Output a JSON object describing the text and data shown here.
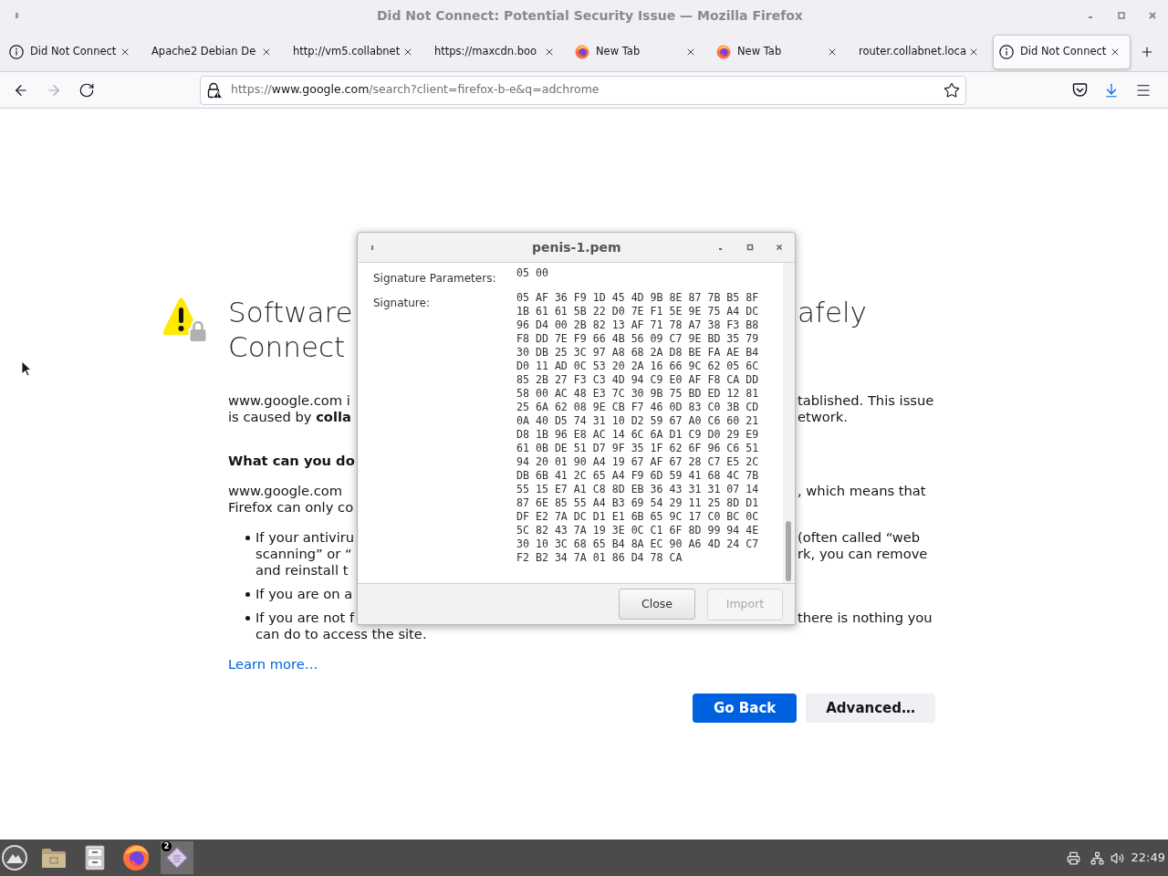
{
  "window": {
    "title": "Did Not Connect: Potential Security Issue — Mozilla Firefox"
  },
  "tabs": [
    {
      "label": "Did Not Connect",
      "kind": "info",
      "selected": false
    },
    {
      "label": "Apache2 Debian De",
      "kind": "plain",
      "selected": false
    },
    {
      "label": "http://vm5.collabnet",
      "kind": "plain",
      "selected": false
    },
    {
      "label": "https://maxcdn.boo",
      "kind": "plain",
      "selected": false
    },
    {
      "label": "New Tab",
      "kind": "browser",
      "selected": false
    },
    {
      "label": "New Tab",
      "kind": "browser",
      "selected": false
    },
    {
      "label": "router.collabnet.loca",
      "kind": "plain",
      "selected": false
    },
    {
      "label": "Did Not Connect",
      "kind": "info",
      "selected": true
    }
  ],
  "nav_buttons": [
    {
      "disabled": false
    },
    {
      "disabled": true
    },
    {
      "disabled": false
    }
  ],
  "address_bar": {
    "scheme": "https://",
    "host": "www.google.com",
    "path": "/search?client=firefox-b-e&q=adchrome"
  },
  "page": {
    "heading": [
      {
        "left": "Software",
        "right": "afely"
      },
      {
        "left": "Connect"
      }
    ],
    "summary": [
      {
        "left": "www.google.com i",
        "right": "tablished. This issue"
      },
      {
        "left": "is caused by **colla**",
        "right": "etwork."
      }
    ],
    "subheading": "What can you do",
    "explanation": [
      {
        "left": "www.google.com",
        "right": ", which means that"
      },
      {
        "left": "Firefox can only co"
      }
    ],
    "suggestions": [
      {
        "lines": [
          {
            "left": "If your antiviru",
            "right": "(often called “web"
          },
          {
            "left": "scanning” or “",
            "right": "rk, you can remove"
          },
          {
            "left": "and reinstall t"
          }
        ]
      },
      {
        "lines": [
          {
            "left": "If you are on a"
          }
        ]
      },
      {
        "lines": [
          {
            "left": "If you are not f",
            "right": "there is nothing you"
          },
          {
            "left": "can do to access the site."
          }
        ]
      }
    ],
    "learn_more": "Learn more…",
    "actions": [
      {
        "label": "Go Back",
        "kind": "primary"
      },
      {
        "label": "Advanced…",
        "kind": "secondary"
      }
    ]
  },
  "dialog": {
    "title": "penis-1.pem",
    "fields": [
      {
        "label": "Signature Parameters:",
        "lines": [
          "05 00"
        ]
      },
      {
        "label": "Signature:",
        "lines": [
          "05 AF 36 F9 1D 45 4D 9B 8E 87 7B B5 8F",
          "1B 61 61 5B 22 D0 7E F1 5E 9E 75 A4 DC",
          "96 D4 00 2B 82 13 AF 71 78 A7 38 F3 B8",
          "F8 DD 7E F9 66 4B 56 09 C7 9E BD 35 79",
          "30 DB 25 3C 97 A8 68 2A D8 BE FA AE B4",
          "D0 11 AD 0C 53 20 2A 16 66 9C 62 05 6C",
          "85 2B 27 F3 C3 4D 94 C9 E0 AF F8 CA DD",
          "58 00 AC 48 E3 7C 30 9B 75 BD ED 12 81",
          "25 6A 62 08 9E CB F7 46 0D 83 C0 3B CD",
          "0A 40 D5 74 31 10 D2 59 67 A0 C6 60 21",
          "D8 1B 96 E8 AC 14 6C 6A D1 C9 D0 29 E9",
          "61 0B DE 51 D7 9F 35 1F 62 6F 96 C6 51",
          "94 20 01 90 A4 19 67 AF 67 28 C7 E5 2C",
          "DB 6B 41 2C 65 A4 F9 6D 59 41 68 4C 7B",
          "55 15 E7 A1 C8 8D EB 36 43 31 31 07 14",
          "87 6E 85 55 A4 B3 69 54 29 11 25 8D D1",
          "DF E2 7A DC D1 E1 6B 65 9C 17 C0 BC 0C",
          "5C 82 43 7A 19 3E 0C C1 6F 8D 99 94 4E",
          "30 10 3C 68 65 B4 8A EC 90 A6 4D 24 C7",
          "F2 B2 34 7A 01 86 D4 78 CA"
        ]
      }
    ],
    "buttons": [
      {
        "label": "Close",
        "disabled": false
      },
      {
        "label": "Import",
        "disabled": true
      }
    ]
  },
  "taskbar": {
    "items": [
      {
        "selected": false
      },
      {
        "selected": false
      },
      {
        "selected": false
      },
      {
        "selected": false
      },
      {
        "selected": true,
        "badge": "2"
      }
    ],
    "clock": "22:49"
  }
}
